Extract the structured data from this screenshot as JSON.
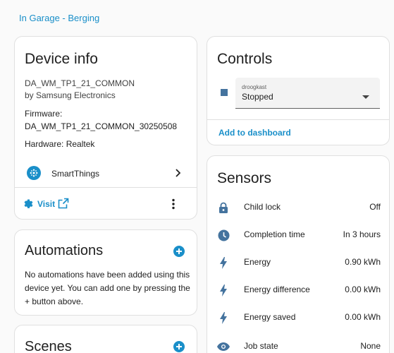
{
  "breadcrumb": "In Garage - Berging",
  "device_info": {
    "title": "Device info",
    "model": "DA_WM_TP1_21_COMMON",
    "manufacturer": "by Samsung Electronics",
    "firmware_label": "Firmware:",
    "firmware_value": "DA_WM_TP1_21_COMMON_30250508",
    "hardware": "Hardware: Realtek",
    "integration": "SmartThings",
    "visit": "Visit"
  },
  "automations": {
    "title": "Automations",
    "text": "No automations have been added using this device yet. You can add one by pressing the + button above."
  },
  "scenes": {
    "title": "Scenes"
  },
  "controls": {
    "title": "Controls",
    "select_label": "droogkast",
    "select_value": "Stopped",
    "add_to_dashboard": "Add to dashboard"
  },
  "sensors": {
    "title": "Sensors",
    "items": [
      {
        "icon": "lock-icon",
        "name": "Child lock",
        "value": "Off"
      },
      {
        "icon": "clock-icon",
        "name": "Completion time",
        "value": "In 3 hours"
      },
      {
        "icon": "lightning-icon",
        "name": "Energy",
        "value": "0.90 kWh"
      },
      {
        "icon": "lightning-icon",
        "name": "Energy difference",
        "value": "0.00 kWh"
      },
      {
        "icon": "lightning-icon",
        "name": "Energy saved",
        "value": "0.00 kWh"
      },
      {
        "icon": "eye-icon",
        "name": "Job state",
        "value": "None"
      }
    ]
  },
  "colors": {
    "accent": "#1a8fc9",
    "icon": "#44739e",
    "text": "#212121"
  }
}
